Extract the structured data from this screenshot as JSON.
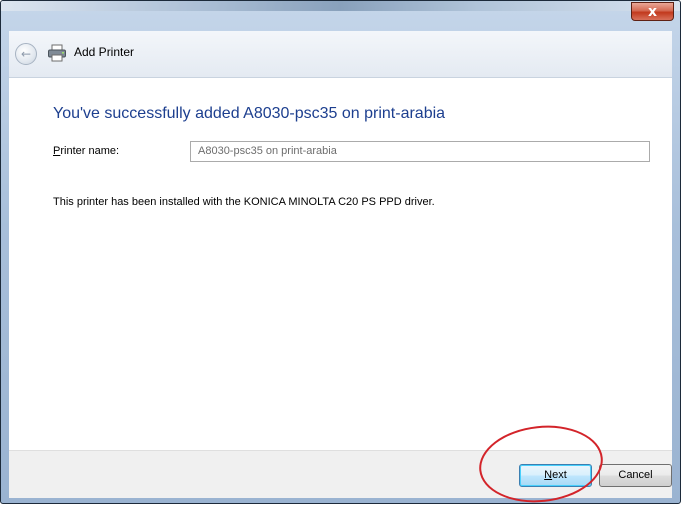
{
  "window": {
    "close_glyph": "x",
    "title_bar_color": "#a8bfda"
  },
  "nav": {
    "back_icon": "back-arrow-icon",
    "app_icon": "printer-icon",
    "title": "Add Printer"
  },
  "content": {
    "heading": "You've successfully added A8030-psc35 on print-arabia",
    "heading_color": "#1d3f8f",
    "printer_name_label_hotkey": "P",
    "printer_name_label_rest": "rinter name:",
    "printer_name_value": "A8030-psc35 on print-arabia",
    "info_text": "This printer has been installed with the KONICA MINOLTA C20 PS PPD driver."
  },
  "footer": {
    "next_hotkey": "N",
    "next_rest": "ext",
    "cancel_label": "Cancel"
  },
  "annotation": {
    "shape": "red-ellipse",
    "color": "#d3242a"
  }
}
